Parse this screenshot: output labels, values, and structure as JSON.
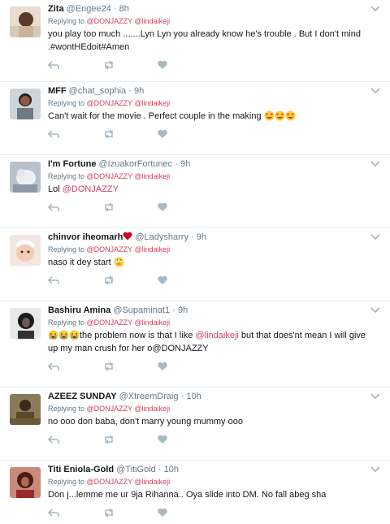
{
  "tweets": [
    {
      "name": "Zita",
      "handle": "@Engee24",
      "time": "8h",
      "reply_prefix": "Replying to",
      "reply_to": "@DONJAZZY @lindaikeji",
      "text": "you play too much .......Lyn Lyn you already know he's trouble . But I don't mind .#wontHEdoit#Amen"
    },
    {
      "name": "MFF",
      "handle": "@chat_sophia",
      "time": "9h",
      "reply_prefix": "Replying to",
      "reply_to": "@DONJAZZY @lindaikeji",
      "text": "Can't wait for the movie . Perfect couple in the making"
    },
    {
      "name": "I'm Fortune",
      "handle": "@IzuakorFortunec",
      "time": "9h",
      "reply_prefix": "Replying to",
      "reply_to": "@DONJAZZY @lindaikeji",
      "text_prefix": "Lol",
      "text_mention": "@DONJAZZY"
    },
    {
      "name": "chinvor iheomarh",
      "handle": "@Ladysharry",
      "time": "9h",
      "reply_prefix": "Replying to",
      "reply_to": "@DONJAZZY @lindaikeji",
      "text": "naso it dey start"
    },
    {
      "name": "Bashiru Amina",
      "handle": "@Supaminat1",
      "time": "9h",
      "reply_prefix": "Replying to",
      "reply_to": "@DONJAZZY @lindaikeji",
      "text_a": "the problem now is that I like",
      "text_mention": "@lindaikeji",
      "text_b": "but that does'nt mean I will give up my man crush for her o@DONJAZZY"
    },
    {
      "name": "AZEEZ SUNDAY",
      "handle": "@XtreemDraig",
      "time": "10h",
      "reply_prefix": "Replying to",
      "reply_to": "@DONJAZZY @lindaikeji",
      "text": "no ooo don baba, don't marry young mummy ooo"
    },
    {
      "name": "Titi Eniola-Gold",
      "handle": "@TitiGold",
      "time": "10h",
      "reply_prefix": "Replying to",
      "reply_to": "@DONJAZZY @lindaikeji",
      "text": "Don j...lemme me ur 9ja Rihanna..  Oya slide into DM. No fall abeg sha"
    }
  ],
  "separator": "·",
  "colors": {
    "mention": "#d4405f",
    "muted": "#657786",
    "icon": "#aab8c2",
    "divider": "#e6ecf0",
    "heart_emoji": "#d0021b"
  }
}
